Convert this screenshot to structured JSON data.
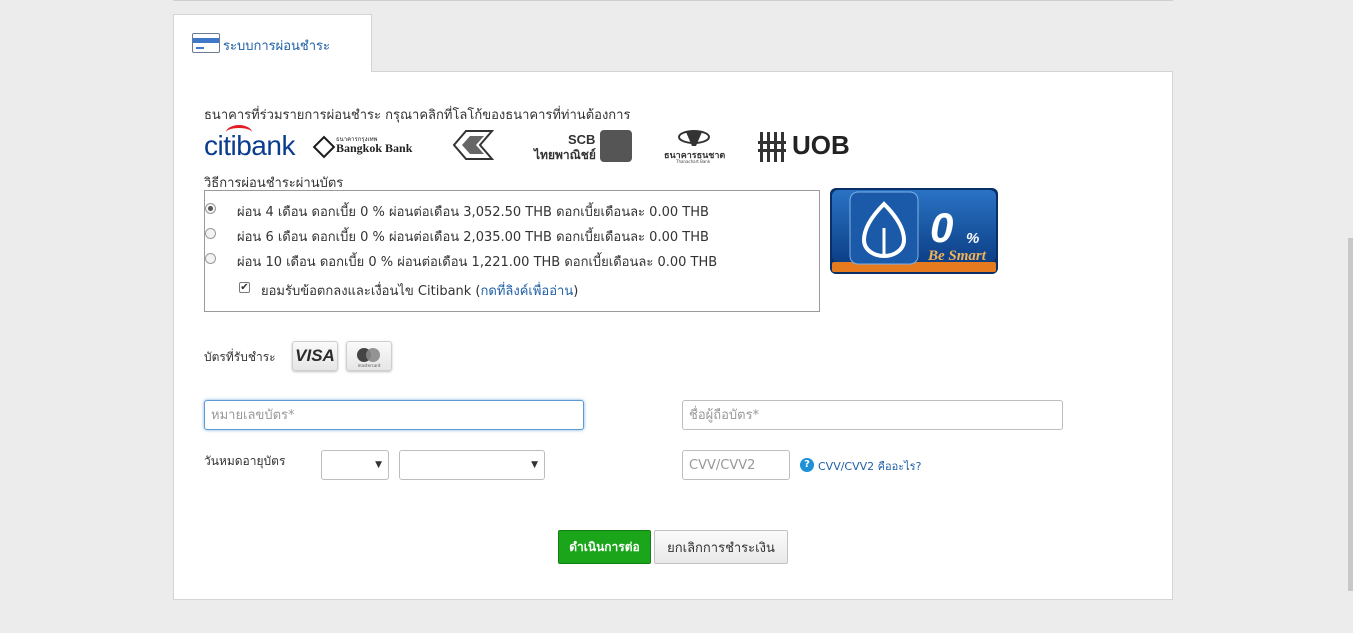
{
  "tab": {
    "label": "ระบบการผ่อนชำระ",
    "icon": "credit-card-icon"
  },
  "banks": {
    "instruction": "ธนาคารที่ร่วมรายการผ่อนชำระ กรุณาคลิกที่โลโก้ของธนาคารที่ท่านต้องการ",
    "citibank": "citibank",
    "bangkok_bank_thai": "ธนาคารกรุงเทพ",
    "bangkok_bank": "Bangkok Bank",
    "scb": "SCB",
    "scb_thai": "ไทยพาณิชย์",
    "thanachart_thai": "ธนาคารธนชาต",
    "thanachart": "Thanachart Bank",
    "uob": "UOB"
  },
  "installment": {
    "title": "วิธีการผ่อนชำระผ่านบัตร",
    "selected_index": 0,
    "options": [
      "ผ่อน 4 เดือน ดอกเบี้ย 0 % ผ่อนต่อเดือน 3,052.50 THB ดอกเบี้ยเดือนละ 0.00 THB",
      "ผ่อน 6 เดือน ดอกเบี้ย 0 % ผ่อนต่อเดือน 2,035.00 THB ดอกเบี้ยเดือนละ 0.00 THB",
      "ผ่อน 10 เดือน ดอกเบี้ย 0 % ผ่อนต่อเดือน 1,221.00 THB ดอกเบี้ยเดือนละ 0.00 THB"
    ],
    "terms_prefix": "ยอมรับข้อตกลงและเงื่อนไข Citibank (",
    "terms_link": "กดที่ลิงค์เพื่ออ่าน",
    "terms_suffix": ")",
    "terms_checked": true
  },
  "promo": {
    "zero": "0",
    "percent": "%",
    "tagline": "Be Smart"
  },
  "cards": {
    "label": "บัตรที่รับชำระ",
    "visa": "VISA",
    "mastercard": "mastercard"
  },
  "form": {
    "card_number_placeholder": "หมายเลขบัตร*",
    "cardholder_placeholder": "ชื่อผู้ถือบัตร*",
    "expiry_label": "วันหมดอายุบัตร",
    "cvv_placeholder": "CVV/CVV2",
    "cvv_help": "CVV/CVV2 คืออะไร?",
    "help_glyph": "?",
    "arrow_glyph": "▼"
  },
  "buttons": {
    "continue": "ดำเนินการต่อ",
    "cancel": "ยกเลิกการชำระเงิน"
  },
  "colors": {
    "accent": "#1f5fa8",
    "continue": "#1aa51a",
    "promo": "#1b5aa8",
    "promo_bar": "#e57b1e"
  }
}
